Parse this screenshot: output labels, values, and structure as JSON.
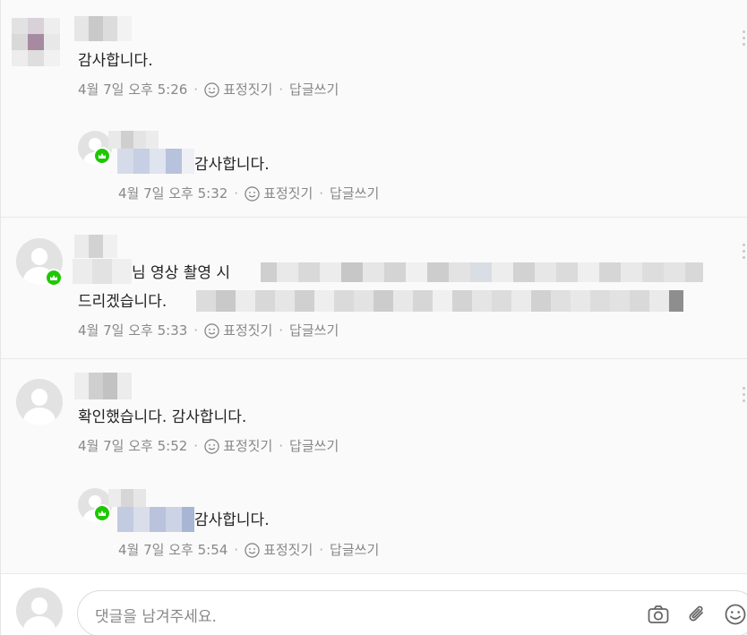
{
  "comments": [
    {
      "text": "감사합니다.",
      "time": "4월 7일 오후 5:26",
      "react": "표정짓기",
      "reply": "답글쓰기"
    },
    {
      "text": "감사합니다.",
      "time": "4월 7일 오후 5:32",
      "react": "표정짓기",
      "reply": "답글쓰기"
    },
    {
      "text_line1": "님 영상 촬영 시",
      "text_line2": "드리겠습니다.",
      "time": "4월 7일 오후 5:33",
      "react": "표정짓기",
      "reply": "답글쓰기"
    },
    {
      "text": "확인했습니다. 감사합니다.",
      "time": "4월 7일 오후 5:52",
      "react": "표정짓기",
      "reply": "답글쓰기"
    },
    {
      "text": "감사합니다.",
      "time": "4월 7일 오후 5:54",
      "react": "표정짓기",
      "reply": "답글쓰기"
    }
  ],
  "write": {
    "placeholder": "댓글을 남겨주세요."
  },
  "icons": {
    "react": "smile-icon",
    "camera": "camera-icon",
    "attach": "paperclip-icon",
    "emoji": "emoji-icon",
    "more": "kebab-icon",
    "badge": "crown-badge-icon"
  },
  "colors": {
    "badge": "#1ec800",
    "meta": "#888888",
    "text": "#222222"
  }
}
